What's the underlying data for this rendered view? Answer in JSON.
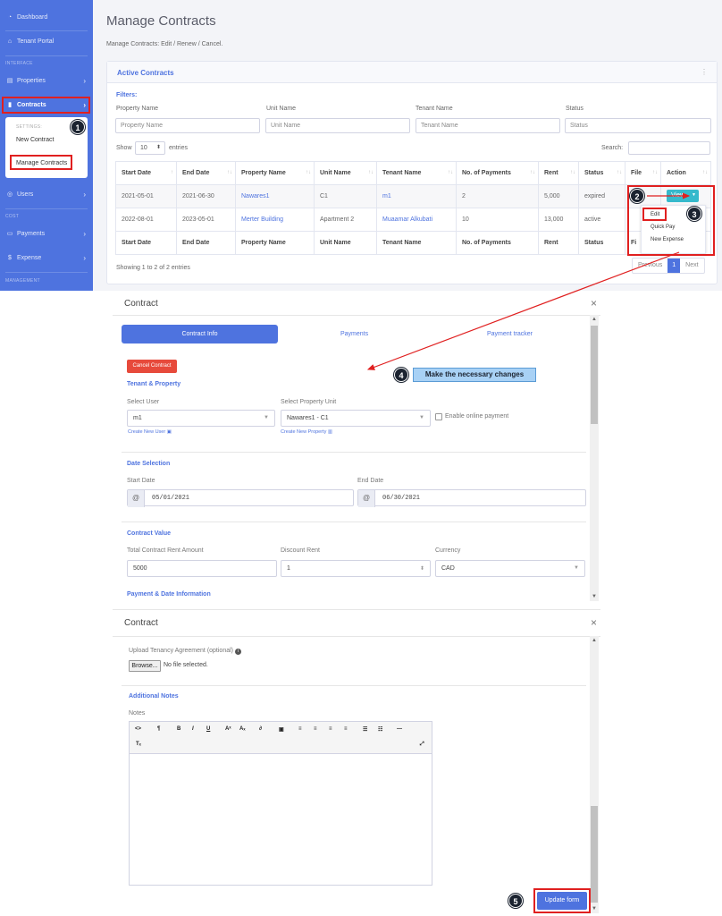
{
  "sidebar": {
    "items": {
      "dashboard": "Dashboard",
      "tenant_portal": "Tenant Portal",
      "properties": "Properties",
      "contracts": "Contracts",
      "users": "Users",
      "payments": "Payments",
      "expense": "Expense"
    },
    "headings": {
      "interface": "INTERFACE",
      "cost": "COST",
      "management": "MANAGEMENT"
    },
    "submenu": {
      "heading": "SETTINGS:",
      "new_contract": "New Contract",
      "manage_contracts": "Manage Contracts"
    }
  },
  "page": {
    "title": "Manage Contracts",
    "subtitle": "Manage Contracts: Edit / Renew / Cancel."
  },
  "card": {
    "title": "Active Contracts",
    "menu_icon": "⋮",
    "filters_label": "Filters:",
    "filters": [
      {
        "label": "Property Name",
        "placeholder": "Property Name"
      },
      {
        "label": "Unit Name",
        "placeholder": "Unit Name"
      },
      {
        "label": "Tenant Name",
        "placeholder": "Tenant Name"
      },
      {
        "label": "Status",
        "placeholder": "Status"
      }
    ],
    "show_label": "Show",
    "show_value": "10",
    "entries_label": "entries",
    "search_label": "Search:",
    "columns": [
      "Start Date",
      "End Date",
      "Property Name",
      "Unit Name",
      "Tenant Name",
      "No. of Payments",
      "Rent",
      "Status",
      "File",
      "Action"
    ],
    "rows": [
      {
        "start": "2021-05-01",
        "end": "2021-06-30",
        "property": "Nawares1",
        "unit": "C1",
        "tenant": "m1",
        "payments": "2",
        "rent": "5,000",
        "status": "expired"
      },
      {
        "start": "2022-08-01",
        "end": "2023-05-01",
        "property": "Merter Building",
        "unit": "Apartment 2",
        "tenant": "Muaamar Alkubati",
        "payments": "10",
        "rent": "13,000",
        "status": "active"
      }
    ],
    "footer_file": "Fi",
    "showing": "Showing 1 to 2 of 2 entries",
    "pager": {
      "previous": "Previous",
      "page": "1",
      "next": "Next"
    },
    "view_button": "View",
    "dropdown": {
      "edit": "Edit",
      "quick_pay": "Quick Pay",
      "new_expense": "New Expense"
    }
  },
  "annotations": {
    "step1": "1",
    "step2": "2",
    "step3": "3",
    "step4": "4",
    "step5": "5",
    "callout": "Make the necessary changes"
  },
  "modal1": {
    "title": "Contract",
    "close": "×",
    "tabs": {
      "info": "Contract Info",
      "payments": "Payments",
      "tracker": "Payment tracker"
    },
    "cancel_button": "Cancel Contract",
    "tenant_section": "Tenant & Property",
    "select_user_label": "Select User",
    "select_user_value": "m1",
    "select_unit_label": "Select Property Unit",
    "select_unit_value": "Nawares1 - C1",
    "online_payment": "Enable online payment",
    "create_user": "Create New User",
    "create_property": "Create New Property",
    "date_section": "Date Selection",
    "start_label": "Start Date",
    "start_value": "05/01/2021",
    "end_label": "End Date",
    "end_value": "06/30/2021",
    "value_section": "Contract Value",
    "total_label": "Total Contract Rent Amount",
    "total_value": "5000",
    "discount_label": "Discount Rent",
    "discount_value": "1",
    "currency_label": "Currency",
    "currency_value": "CAD",
    "payment_section": "Payment & Date Information"
  },
  "modal2": {
    "title": "Contract",
    "close": "×",
    "upload_label": "Upload Tenancy Agreement (optional)",
    "browse": "Browse...",
    "no_file": "No file selected.",
    "notes_section": "Additional Notes",
    "notes_label": "Notes",
    "update_button": "Update form"
  },
  "colors": {
    "primary": "#4e73df",
    "danger": "#e74a3b",
    "info": "#36b9cc",
    "highlight": "#e02020"
  }
}
